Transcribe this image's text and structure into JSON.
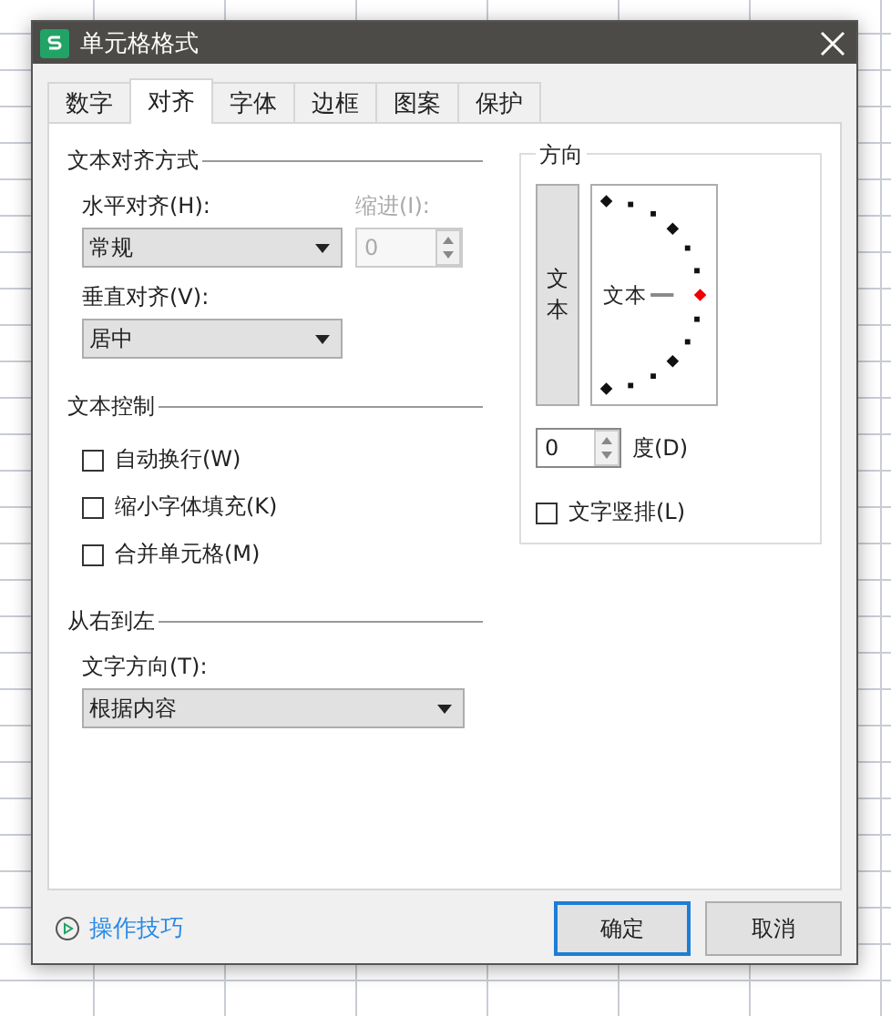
{
  "window": {
    "title": "单元格格式"
  },
  "tabs": [
    {
      "label": "数字",
      "selected": false
    },
    {
      "label": "对齐",
      "selected": true
    },
    {
      "label": "字体",
      "selected": false
    },
    {
      "label": "边框",
      "selected": false
    },
    {
      "label": "图案",
      "selected": false
    },
    {
      "label": "保护",
      "selected": false
    }
  ],
  "text_alignment": {
    "title": "文本对齐方式",
    "horizontal": {
      "label": "水平对齐(H):",
      "value": "常规"
    },
    "indent": {
      "label": "缩进(I):",
      "value": "0",
      "disabled": true
    },
    "vertical": {
      "label": "垂直对齐(V):",
      "value": "居中"
    }
  },
  "text_control": {
    "title": "文本控制",
    "options": [
      {
        "label": "自动换行(W)",
        "checked": false
      },
      {
        "label": "缩小字体填充(K)",
        "checked": false
      },
      {
        "label": "合并单元格(M)",
        "checked": false
      }
    ]
  },
  "right_to_left": {
    "title": "从右到左",
    "direction": {
      "label": "文字方向(T):",
      "value": "根据内容"
    }
  },
  "orientation": {
    "title": "方向",
    "vertical_text": "文本",
    "dial_text": "文本",
    "degrees": {
      "value": "0",
      "unit": "度(D)"
    },
    "vertical_stack": {
      "label": "文字竖排(L)",
      "checked": false
    }
  },
  "footer": {
    "tips_link": "操作技巧",
    "buttons": [
      {
        "label": "确定",
        "default": true
      },
      {
        "label": "取消",
        "default": false
      }
    ]
  }
}
